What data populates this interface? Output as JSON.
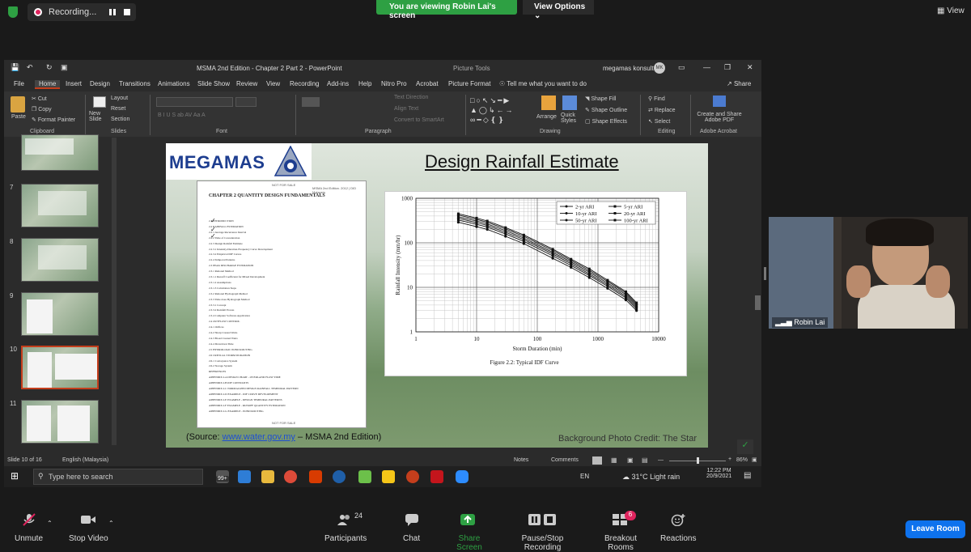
{
  "zoom": {
    "recording_label": "Recording...",
    "viewing_banner": "You are viewing Robin Lai's screen",
    "view_options": "View Options",
    "view_label": "View",
    "participant_name": "Robin Lai",
    "bottom": {
      "unmute": "Unmute",
      "stop_video": "Stop Video",
      "participants": "Participants",
      "participants_count": "24",
      "chat": "Chat",
      "share_screen": "Share Screen",
      "pause_stop_recording": "Pause/Stop Recording",
      "breakout_rooms": "Breakout Rooms",
      "breakout_badge": "6",
      "reactions": "Reactions",
      "leave": "Leave Room"
    },
    "colors": {
      "green": "#2ea043",
      "blue": "#0e72ed",
      "red": "#e0245e"
    }
  },
  "ppt": {
    "window_title": "MSMA 2nd Edition - Chapter 2 Part 2  -  PowerPoint",
    "picture_tools": "Picture Tools",
    "account": "megamas konsult",
    "avatar_initials": "MK",
    "tabs": [
      "File",
      "Home",
      "Insert",
      "Design",
      "Transitions",
      "Animations",
      "Slide Show",
      "Review",
      "View",
      "Recording",
      "Add-ins",
      "Help",
      "Nitro Pro",
      "Acrobat",
      "Picture Format"
    ],
    "active_tab": "Home",
    "tell_me": "Tell me what you want to do",
    "share": "Share",
    "ribbon": {
      "paste": "Paste",
      "cut": "Cut",
      "copy": "Copy",
      "format_painter": "Format Painter",
      "clipboard": "Clipboard",
      "new_slide": "New Slide",
      "layout": "Layout",
      "reset": "Reset",
      "section": "Section",
      "slides": "Slides",
      "font": "Font",
      "text_direction": "Text Direction",
      "align_text": "Align Text",
      "convert_smartart": "Convert to SmartArt",
      "paragraph": "Paragraph",
      "arrange": "Arrange",
      "quick_styles": "Quick Styles",
      "shape_fill": "Shape Fill",
      "shape_outline": "Shape Outline",
      "shape_effects": "Shape Effects",
      "drawing": "Drawing",
      "find": "Find",
      "replace": "Replace",
      "select": "Select",
      "editing": "Editing",
      "create_share": "Create and Share Adobe PDF",
      "adobe_acrobat": "Adobe Acrobat"
    },
    "thumbnail_numbers": [
      "7",
      "8",
      "9",
      "10",
      "11"
    ],
    "selected_slide": "10",
    "status": {
      "slide": "Slide 10 of 16",
      "language": "English (Malaysia)",
      "notes": "Notes",
      "comments": "Comments",
      "zoom": "86%"
    }
  },
  "slide": {
    "logo": "MEGAMAS",
    "title": "Design Rainfall Estimate",
    "source_prefix": "(Source: ",
    "source_link": "www.water.gov.my",
    "source_suffix": " – MSMA 2nd Edition)",
    "credit": "Background Photo Credit: The Star",
    "toc": {
      "header_left": "NOT FOR SALE",
      "header_right": "MSMA 2nd Edition. 2012 | DID Malaysia",
      "chapter": "CHAPTER 2    QUANTITY DESIGN FUNDAMENTALS",
      "footer": "NOT FOR SALE",
      "rows": [
        "2.1     INTRODUCTION",
        "2.2     RAINFALL ESTIMATION",
        "   2.2.1   Average Recurrence Interval",
        "   2.2.2   Time of Concentration",
        "   2.2.3   Design Rainfall Estimate",
        "      2.2.3.1  Intensity-Duration-Frequency Curve Development",
        "      2.2.3.2  Empirical IDF Curves",
        "   2.2.4   Temporal Patterns",
        "2.3     PEAK DISCHARGE ESTIMATION",
        "   2.3.1   Rational Method",
        "      2.3.1.1  Runoff Coefficient for Mixed Development",
        "      2.3.1.2  Assumptions",
        "      2.3.1.3  Calculation Steps",
        "   2.3.2   Rational Hydrograph Method",
        "   2.3.3   Time Area Hydrograph Method",
        "      2.3.3.1  Concept",
        "      2.3.3.2  Rainfall Excess",
        "   2.3.4   Computer Software Application",
        "2.4     OUTFLOW CONTROL",
        "   2.4.1   Orifices",
        "   2.4.2   Sharp Crested Weirs",
        "   2.4.3   Broad Crested Weirs",
        "   2.4.4   Drawdown Time",
        "2.5     HYDROLOGIC POND ROUTING",
        "2.6     CRITICAL STORM DURATION",
        "   2.6.1   Conveyance System",
        "   2.6.2   Storage System",
        "REFERENCES",
        "APPENDIX 2.A   DESIGN CHART - OVERLAND FLOW TIME",
        "APPENDIX 2.B   IDF CONSTANTS",
        "APPENDIX 2.C   NORMALIZED DESIGN RAINFALL TEMPORAL PATTERN",
        "APPENDIX 2.D   EXAMPLE - IDF CURVE DEVELOPMENT",
        "APPENDIX 2.E   EXAMPLE - DESIGN TEMPORAL PATTERNS",
        "APPENDIX 2.F   EXAMPLE - RUNOFF QUANTITY ESTIMATION",
        "APPENDIX 2.G   EXAMPLE - POND ROUTING"
      ]
    }
  },
  "chart_data": {
    "type": "line",
    "x_scale": "log",
    "y_scale": "log",
    "xlim": [
      1,
      10000
    ],
    "ylim": [
      1,
      1000
    ],
    "x_ticks": [
      "1",
      "10",
      "100",
      "1000",
      "10000"
    ],
    "y_ticks": [
      "1",
      "10",
      "100",
      "1000"
    ],
    "xlabel": "Storm Duration (min)",
    "ylabel": "Rainfall Intensity (mm/hr)",
    "caption": "Figure 2.2:  Typical IDF Curve",
    "legend_position": "top-right",
    "x": [
      5,
      10,
      15,
      30,
      60,
      180,
      360,
      720,
      1440,
      2880,
      4320
    ],
    "series": [
      {
        "name": "2-yr ARI",
        "values": [
          290,
          230,
          200,
          140,
          96,
          45,
          28,
          16.5,
          9.5,
          5.2,
          3.0
        ]
      },
      {
        "name": "5-yr ARI",
        "values": [
          325,
          260,
          225,
          158,
          108,
          51,
          31,
          18.5,
          10.6,
          5.8,
          3.3
        ]
      },
      {
        "name": "10-yr ARI",
        "values": [
          355,
          285,
          245,
          172,
          118,
          56,
          34,
          20,
          11.5,
          6.3,
          3.6
        ]
      },
      {
        "name": "20-yr ARI",
        "values": [
          385,
          310,
          265,
          187,
          128,
          61,
          37,
          22,
          12.5,
          6.9,
          3.9
        ]
      },
      {
        "name": "50-yr ARI",
        "values": [
          420,
          335,
          290,
          205,
          140,
          67,
          40,
          24,
          13.6,
          7.5,
          4.2
        ]
      },
      {
        "name": "100-yr ARI",
        "values": [
          450,
          360,
          310,
          220,
          150,
          72,
          43,
          26,
          14.5,
          8.0,
          4.5
        ]
      }
    ]
  },
  "taskbar": {
    "search_placeholder": "Type here to search",
    "badge": "99+",
    "lang": "EN",
    "weather": "31°C  Light rain",
    "time": "12:22 PM",
    "date": "20/9/2021"
  }
}
